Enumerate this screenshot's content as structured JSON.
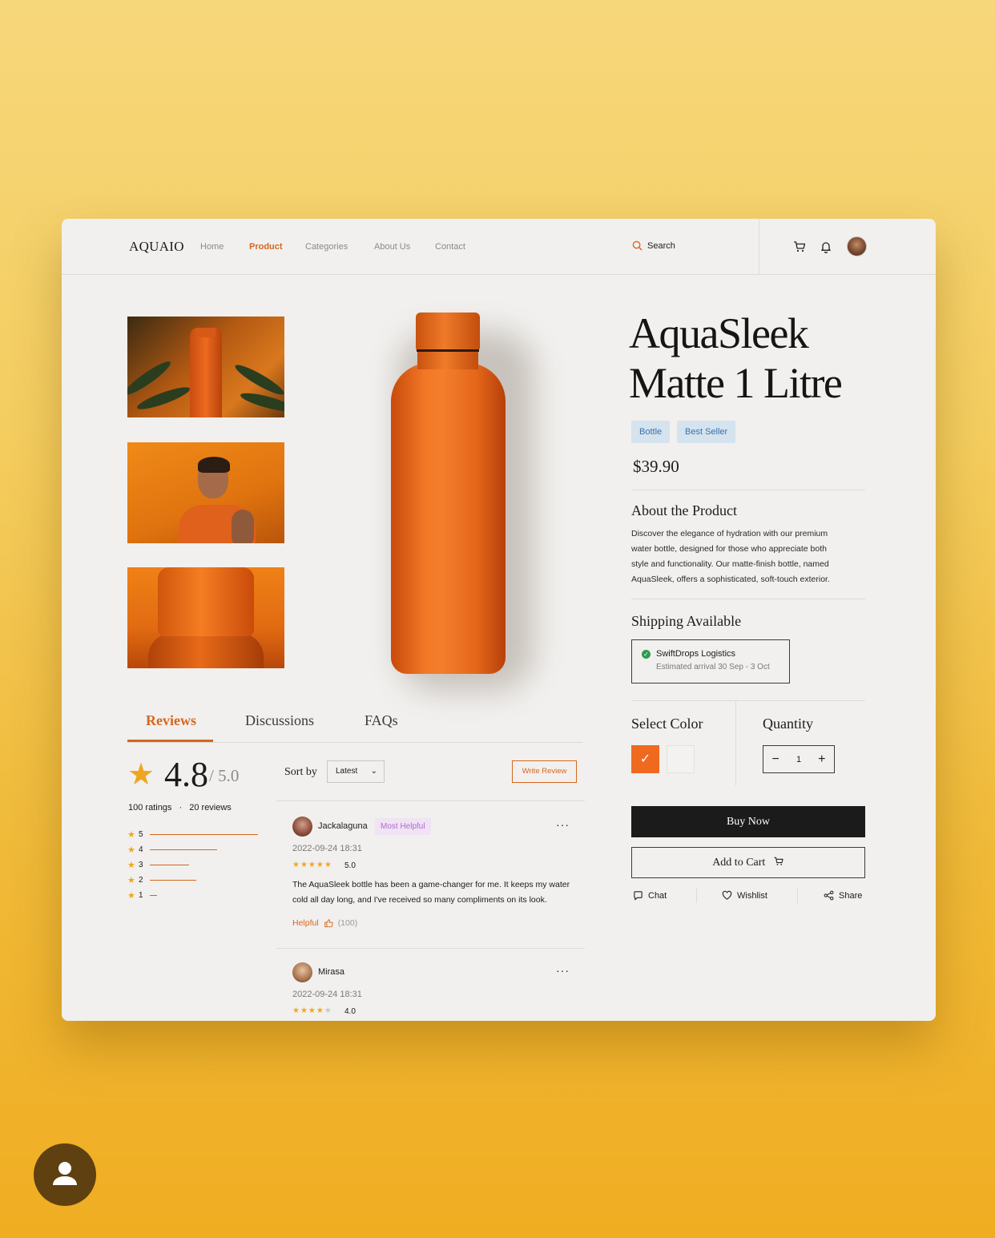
{
  "header": {
    "logo": "AQUAIO",
    "nav": [
      "Home",
      "Product",
      "Categories",
      "About Us",
      "Contact"
    ],
    "active_nav": "Product",
    "search_label": "Search"
  },
  "product": {
    "title_line1": "AquaSleek",
    "title_line2": "Matte 1 Litre",
    "badges": [
      "Bottle",
      "Best Seller"
    ],
    "price": "$39.90",
    "about_title": "About the Product",
    "description": "Discover the elegance of hydration with our premium water bottle, designed for those who appreciate both style and functionality. Our matte-finish bottle, named AquaSleek, offers a sophisticated, soft-touch exterior.",
    "shipping_title": "Shipping Available",
    "shipping_provider": "SwiftDrops Logistics",
    "shipping_estimate": "Estimated arrival 30 Sep - 3 Oct",
    "select_color_label": "Select Color",
    "colors": [
      "#ef6a1e",
      "#f3f2f0"
    ],
    "selected_color": "#ef6a1e",
    "quantity_label": "Quantity",
    "quantity": "1",
    "buy_now": "Buy Now",
    "add_to_cart": "Add to Cart",
    "actions": [
      "Chat",
      "Wishlist",
      "Share"
    ]
  },
  "tabs": [
    "Reviews",
    "Discussions",
    "FAQs"
  ],
  "active_tab": "Reviews",
  "reviews_summary": {
    "rating": "4.8",
    "max": "/ 5.0",
    "ratings_count": "100 ratings",
    "reviews_count": "20 reviews",
    "distribution": [
      {
        "stars": "5",
        "fraction": 1.0
      },
      {
        "stars": "4",
        "fraction": 0.62
      },
      {
        "stars": "3",
        "fraction": 0.36
      },
      {
        "stars": "2",
        "fraction": 0.43
      },
      {
        "stars": "1",
        "fraction": 0.07
      }
    ]
  },
  "sort": {
    "label": "Sort by",
    "value": "Latest",
    "write_review": "Write Review"
  },
  "reviews": [
    {
      "name": "Jackalaguna",
      "tag": "Most Helpful",
      "date": "2022-09-24 18:31",
      "stars": 5,
      "score": "5.0",
      "text": "The AquaSleek bottle has been a game-changer for me. It keeps my water cold all day long, and I've received so many compliments on its look.",
      "helpful_label": "Helpful",
      "helpful_count": "(100)"
    },
    {
      "name": "Mirasa",
      "date": "2022-09-24 18:31",
      "stars": 4,
      "score": "4.0"
    }
  ],
  "icons": [
    "search-icon",
    "cart-icon",
    "bell-icon",
    "star-icon",
    "chevron-down-icon",
    "thumbs-up-icon",
    "chat-icon",
    "heart-icon",
    "share-icon",
    "check-icon",
    "more-icon",
    "user-icon"
  ],
  "colors": {
    "accent": "#d6661f",
    "star": "#f0a51f",
    "badge_bg": "#d5e3ef",
    "badge_text": "#3a72a8",
    "dark": "#1b1b1b"
  }
}
